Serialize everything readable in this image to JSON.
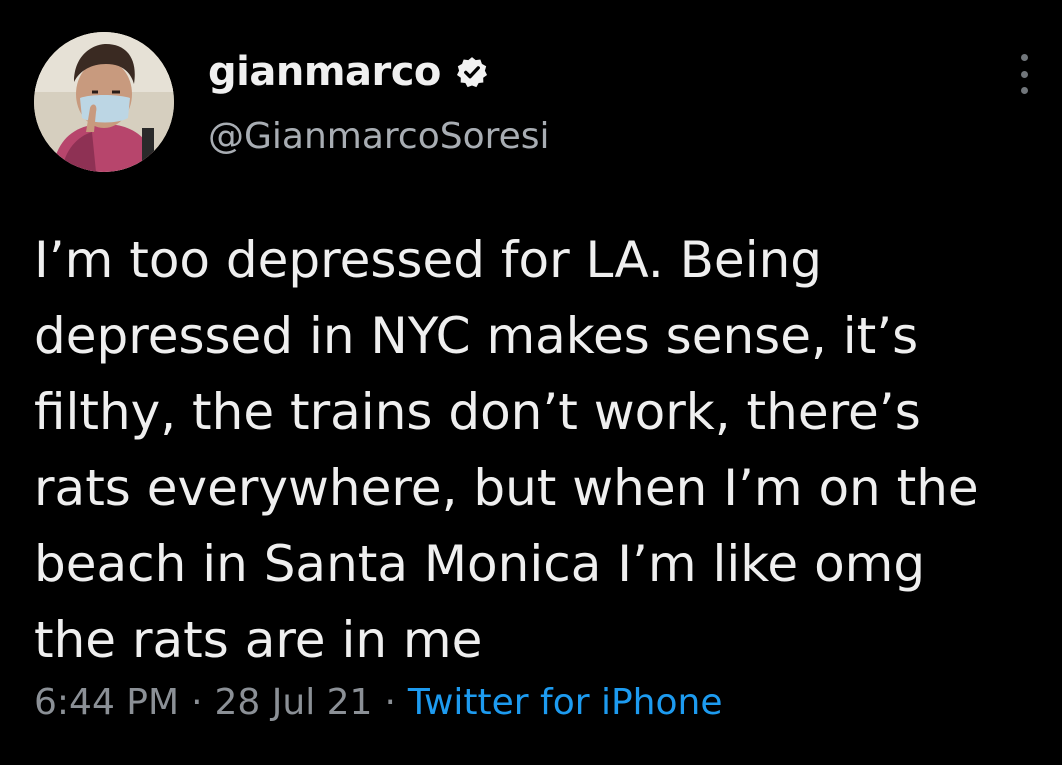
{
  "author": {
    "display_name": "gianmarco",
    "handle": "@GianmarcoSoresi",
    "verified": true
  },
  "tweet": {
    "lines": [
      "I’m too depressed for LA. Being",
      "depressed in NYC makes sense, it’s",
      "filthy, the trains don’t work, there’s",
      "rats everywhere, but when I’m on the",
      "beach in Santa Monica I’m like omg",
      "the rats are in me"
    ]
  },
  "meta": {
    "time": "6:44 PM",
    "separator": "·",
    "date": "28 Jul 21",
    "source": "Twitter for iPhone"
  },
  "icons": {
    "verified": "verified-badge-icon",
    "more": "more-vertical-icon"
  },
  "colors": {
    "background": "#000000",
    "text": "#e7e9ea",
    "secondary": "#8b9096",
    "link": "#1d9bf0"
  }
}
